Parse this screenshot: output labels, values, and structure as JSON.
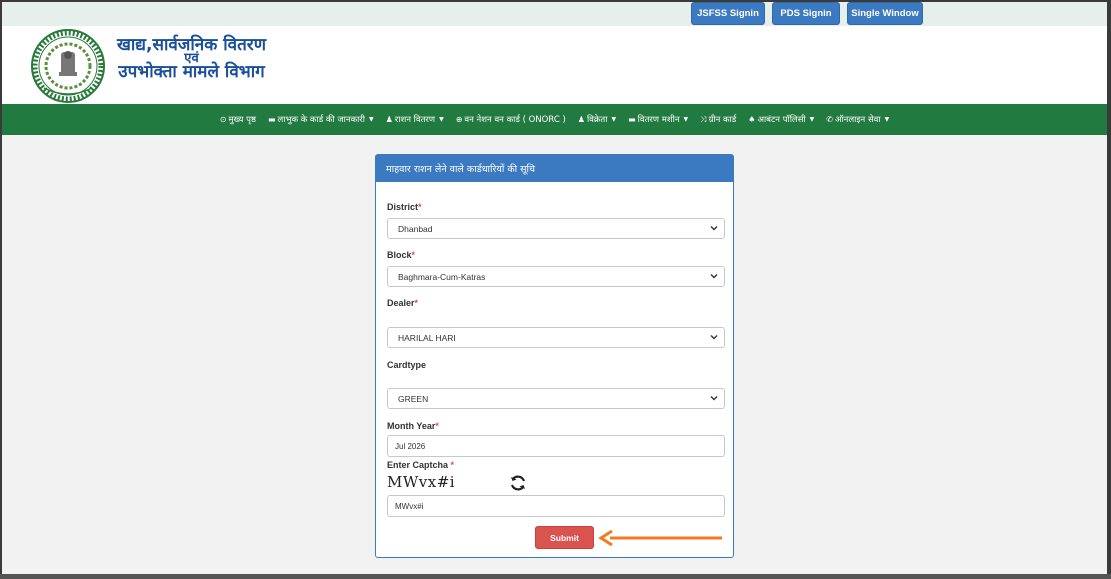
{
  "topbar": {
    "buttons": [
      "JSFSS Signin",
      "PDS Signin",
      "Single Window"
    ]
  },
  "header": {
    "logo_line1": "खाद्य,सार्वजनिक वितरण",
    "logo_line2": "एवं",
    "logo_line3": "उपभोक्ता मामले विभाग",
    "seal_text": "झारखण्ड सरकार"
  },
  "nav": {
    "items": [
      {
        "label": "मुख्य पृष्ठ",
        "icon": "home-icon",
        "dropdown": false
      },
      {
        "label": "लाभुक के कार्ड की जानकारी",
        "icon": "card-icon",
        "dropdown": true
      },
      {
        "label": "राशन वितरण",
        "icon": "user-icon",
        "dropdown": true
      },
      {
        "label": "वन नेशन वन कार्ड ( ONORC )",
        "icon": "globe-icon",
        "dropdown": false
      },
      {
        "label": "विक्रेता",
        "icon": "person-icon",
        "dropdown": true
      },
      {
        "label": "वितरण मशीन",
        "icon": "machine-icon",
        "dropdown": true
      },
      {
        "label": "ग्रीन कार्ड",
        "icon": "shuffle-icon",
        "dropdown": false
      },
      {
        "label": "आबंटन पॉलिसी",
        "icon": "leaf-icon",
        "dropdown": true
      },
      {
        "label": "ऑनलाइन सेवा",
        "icon": "phone-icon",
        "dropdown": true
      }
    ]
  },
  "form": {
    "title": "माहवार राशन लेने वाले कार्डधारियों की सूचि",
    "district_label": "District",
    "district_value": "Dhanbad",
    "block_label": "Block",
    "block_value": "Baghmara-Cum-Katras",
    "dealer_label": "Dealer",
    "dealer_value": "HARILAL HARI",
    "cardtype_label": "Cardtype",
    "cardtype_value": "GREEN",
    "month_label": "Month Year",
    "month_value": "Jul 2026",
    "captcha_label": "Enter Captcha",
    "captcha_image_text": "MWvx#i",
    "captcha_value": "MWvx#i",
    "required_mark": "*",
    "submit_label": "Submit"
  },
  "colors": {
    "nav_green": "#217a3f",
    "primary_blue": "#3b7ac0",
    "submit_red": "#d9534f",
    "annotation_arrow": "#f07c22"
  }
}
